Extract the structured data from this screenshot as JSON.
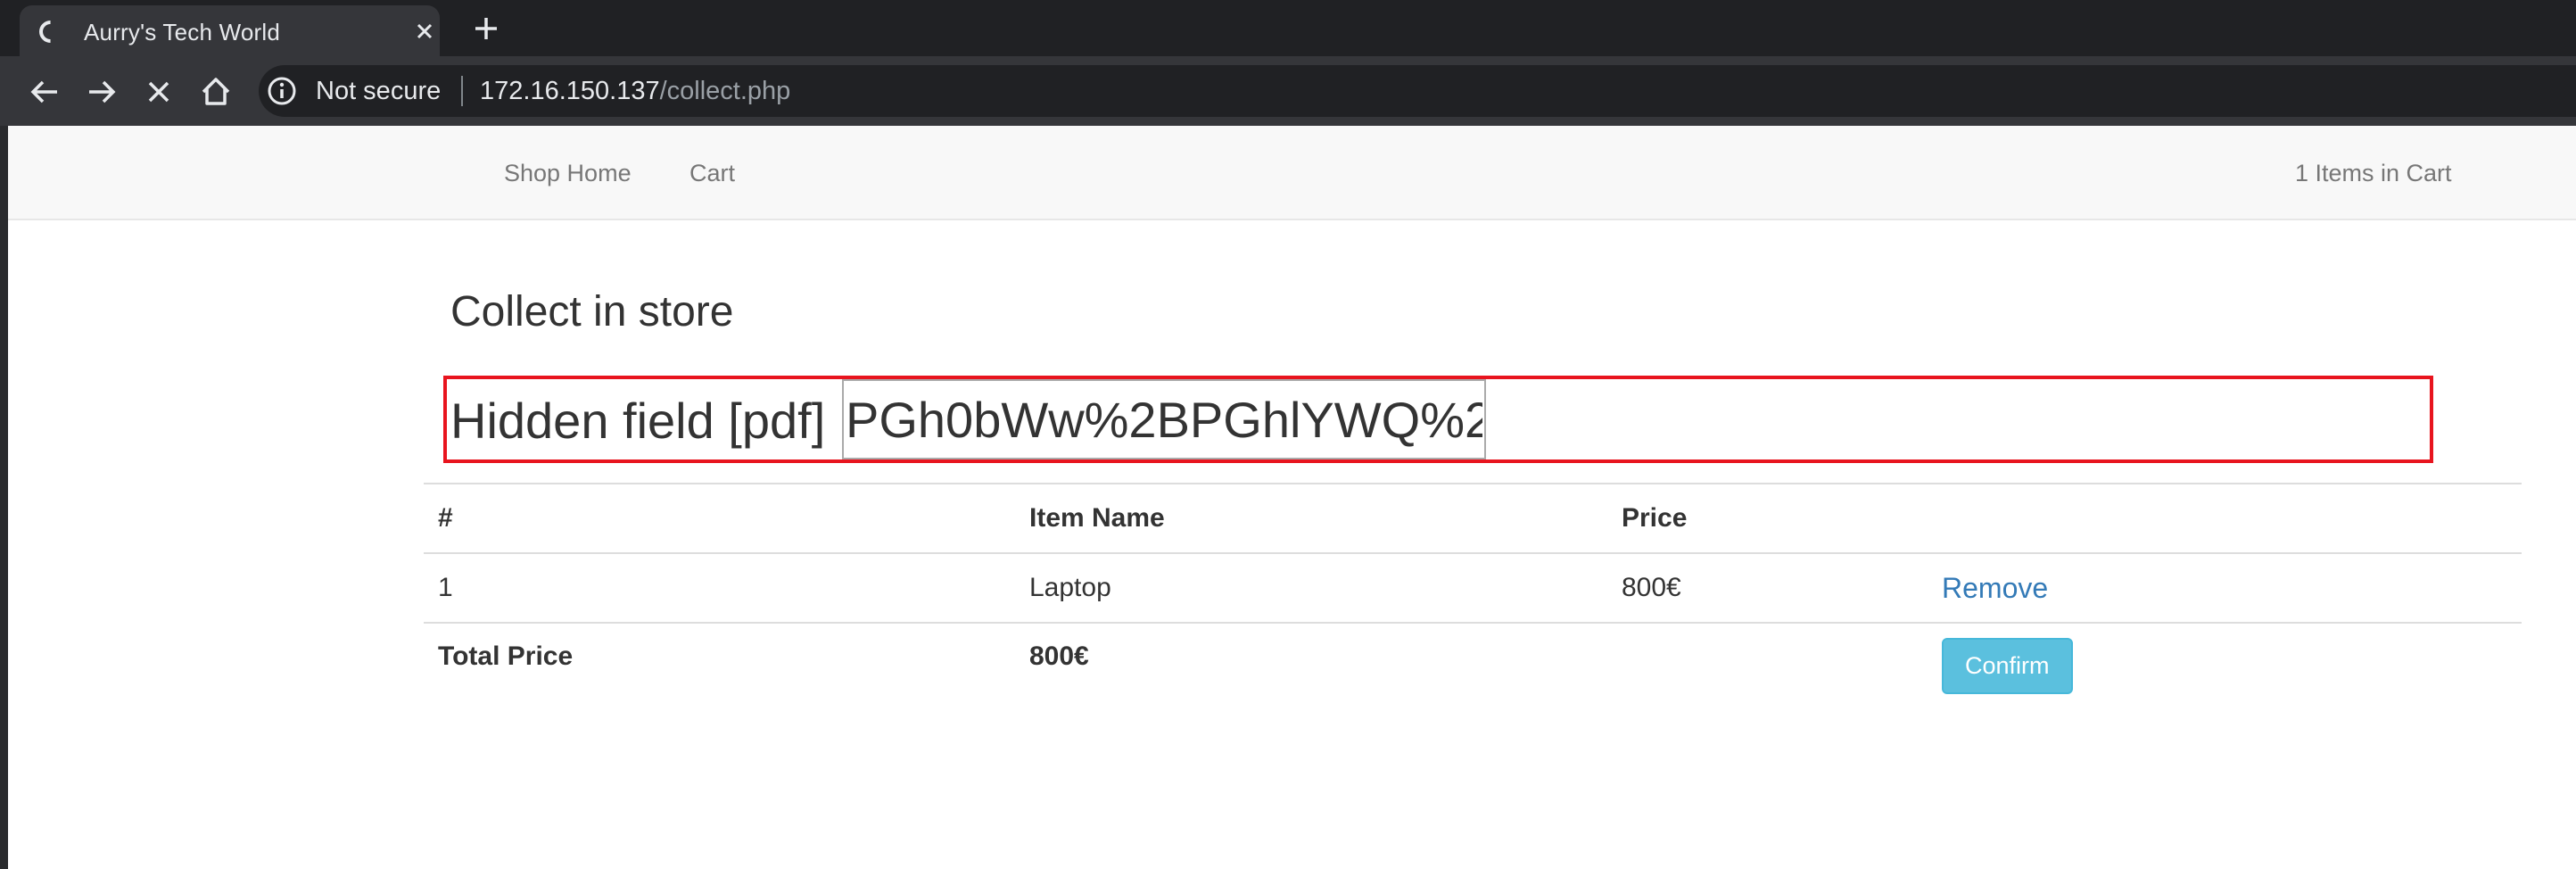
{
  "browser": {
    "tab_title": "Aurry's Tech World",
    "security_label": "Not secure",
    "url_host": "172.16.150.137",
    "url_path": "/collect.php"
  },
  "navbar": {
    "links": [
      "Shop Home",
      "Cart"
    ],
    "cart_count": "1 Items in Cart"
  },
  "page": {
    "heading": "Collect in store",
    "hidden_field_label": "Hidden field [pdf]",
    "hidden_field_value": "PGh0bWw%2BPGhlYWQ%2"
  },
  "table": {
    "headers": [
      "#",
      "Item Name",
      "Price",
      ""
    ],
    "rows": [
      {
        "num": "1",
        "name": "Laptop",
        "price": "800€",
        "action": "Remove"
      }
    ],
    "total_label": "Total Price",
    "total_value": "800€",
    "confirm_label": "Confirm"
  },
  "colors": {
    "highlight_border": "#e8141e",
    "link": "#337ab7",
    "confirm_button": "#5bc0de"
  }
}
